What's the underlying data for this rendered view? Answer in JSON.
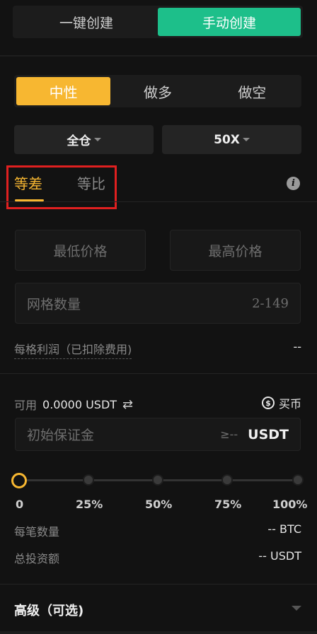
{
  "create_mode": {
    "options": [
      "一键创建",
      "手动创建"
    ],
    "active": "手动创建"
  },
  "direction": {
    "options": [
      "中性",
      "做多",
      "做空"
    ],
    "active": "中性"
  },
  "margin_mode": "全仓",
  "leverage": "50X",
  "grid_type": {
    "tabs": [
      "等差",
      "等比"
    ],
    "active": "等差"
  },
  "price": {
    "low_placeholder": "最低价格",
    "high_placeholder": "最高价格"
  },
  "grid_count": {
    "placeholder": "网格数量",
    "range": "2-149"
  },
  "profit_per_grid": {
    "label": "每格利润（已扣除费用)",
    "value": "--"
  },
  "available": {
    "label": "可用",
    "value": "0.0000 USDT",
    "buy_label": "买币"
  },
  "initial_margin": {
    "placeholder": "初始保证金",
    "min": "≥--",
    "unit": "USDT"
  },
  "slider": {
    "value_percent": 0,
    "ticks": [
      "0",
      "25%",
      "50%",
      "75%",
      "100%"
    ]
  },
  "per_order_qty": {
    "label": "每笔数量",
    "value": "-- BTC"
  },
  "total_investment": {
    "label": "总投资额",
    "value": "-- USDT"
  },
  "advanced": {
    "label": "高级（可选)"
  },
  "colors": {
    "accent_green": "#1dbf8a",
    "accent_yellow": "#f7b731",
    "highlight_red": "#e02020"
  }
}
